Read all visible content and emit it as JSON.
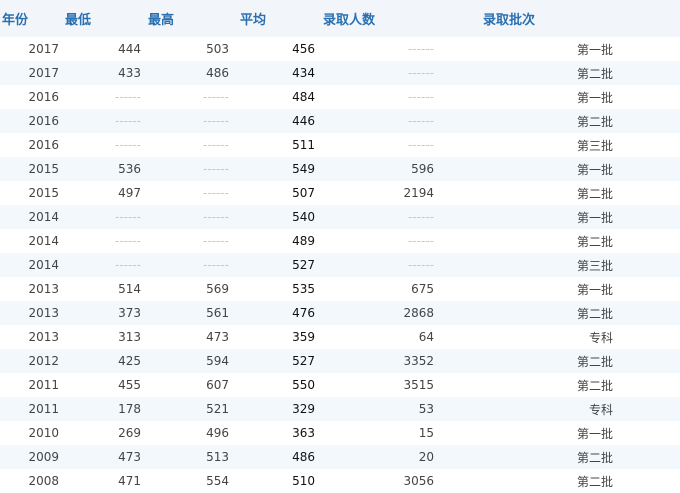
{
  "table": {
    "headers": [
      "年份",
      "最低",
      "最高",
      "平均",
      "录取人数",
      "录取批次"
    ],
    "rows": [
      {
        "year": "2017",
        "min": "444",
        "max": "503",
        "avg": "456",
        "count": "------",
        "batch": "第一批"
      },
      {
        "year": "2017",
        "min": "433",
        "max": "486",
        "avg": "434",
        "count": "------",
        "batch": "第二批"
      },
      {
        "year": "2016",
        "min": "------",
        "max": "------",
        "avg": "484",
        "count": "------",
        "batch": "第一批"
      },
      {
        "year": "2016",
        "min": "------",
        "max": "------",
        "avg": "446",
        "count": "------",
        "batch": "第二批"
      },
      {
        "year": "2016",
        "min": "------",
        "max": "------",
        "avg": "511",
        "count": "------",
        "batch": "第三批"
      },
      {
        "year": "2015",
        "min": "536",
        "max": "------",
        "avg": "549",
        "count": "596",
        "batch": "第一批"
      },
      {
        "year": "2015",
        "min": "497",
        "max": "------",
        "avg": "507",
        "count": "2194",
        "batch": "第二批"
      },
      {
        "year": "2014",
        "min": "------",
        "max": "------",
        "avg": "540",
        "count": "------",
        "batch": "第一批"
      },
      {
        "year": "2014",
        "min": "------",
        "max": "------",
        "avg": "489",
        "count": "------",
        "batch": "第二批"
      },
      {
        "year": "2014",
        "min": "------",
        "max": "------",
        "avg": "527",
        "count": "------",
        "batch": "第三批"
      },
      {
        "year": "2013",
        "min": "514",
        "max": "569",
        "avg": "535",
        "count": "675",
        "batch": "第一批"
      },
      {
        "year": "2013",
        "min": "373",
        "max": "561",
        "avg": "476",
        "count": "2868",
        "batch": "第二批"
      },
      {
        "year": "2013",
        "min": "313",
        "max": "473",
        "avg": "359",
        "count": "64",
        "batch": "专科"
      },
      {
        "year": "2012",
        "min": "425",
        "max": "594",
        "avg": "527",
        "count": "3352",
        "batch": "第二批"
      },
      {
        "year": "2011",
        "min": "455",
        "max": "607",
        "avg": "550",
        "count": "3515",
        "batch": "第二批"
      },
      {
        "year": "2011",
        "min": "178",
        "max": "521",
        "avg": "329",
        "count": "53",
        "batch": "专科"
      },
      {
        "year": "2010",
        "min": "269",
        "max": "496",
        "avg": "363",
        "count": "15",
        "batch": "第一批"
      },
      {
        "year": "2009",
        "min": "473",
        "max": "513",
        "avg": "486",
        "count": "20",
        "batch": "第二批"
      },
      {
        "year": "2008",
        "min": "471",
        "max": "554",
        "avg": "510",
        "count": "3056",
        "batch": "第二批"
      }
    ]
  }
}
